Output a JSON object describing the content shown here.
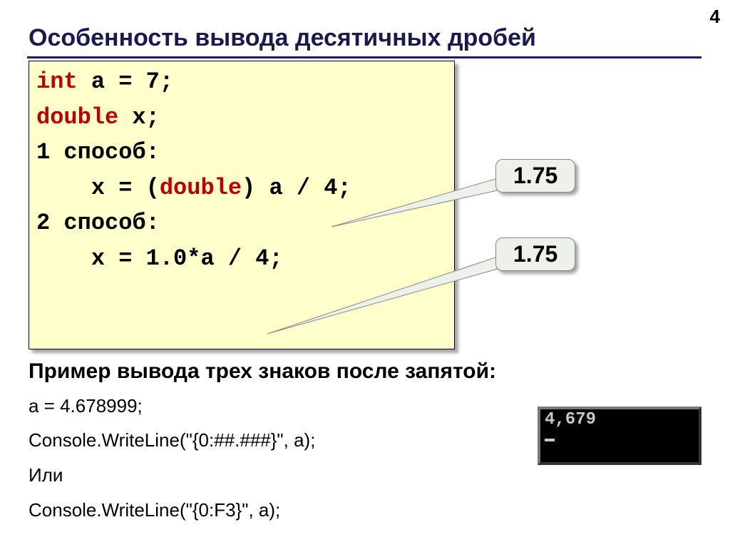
{
  "page_number": "4",
  "heading": "Особенность вывода десятичных дробей",
  "code": {
    "line1a": "int",
    "line1b": " a = 7;",
    "line2a": "double",
    "line2b": " x;",
    "line3": "1 способ:",
    "line4a": "    x = (",
    "line4b": "double",
    "line4c": ") a / 4;",
    "line5": "2 способ:",
    "line6": "    x = 1.0*a / 4;"
  },
  "callouts": {
    "c1": "1.75",
    "c2": "1.75"
  },
  "subheading": "Пример вывода трех знаков после запятой:",
  "examples": {
    "e1": "a = 4.678999;",
    "e2": "Console.WriteLine(\"{0:##.###}\", a);",
    "e3": "Или",
    "e4": "Console.WriteLine(\"{0:F3}\", a);"
  },
  "console_output": "4,679"
}
